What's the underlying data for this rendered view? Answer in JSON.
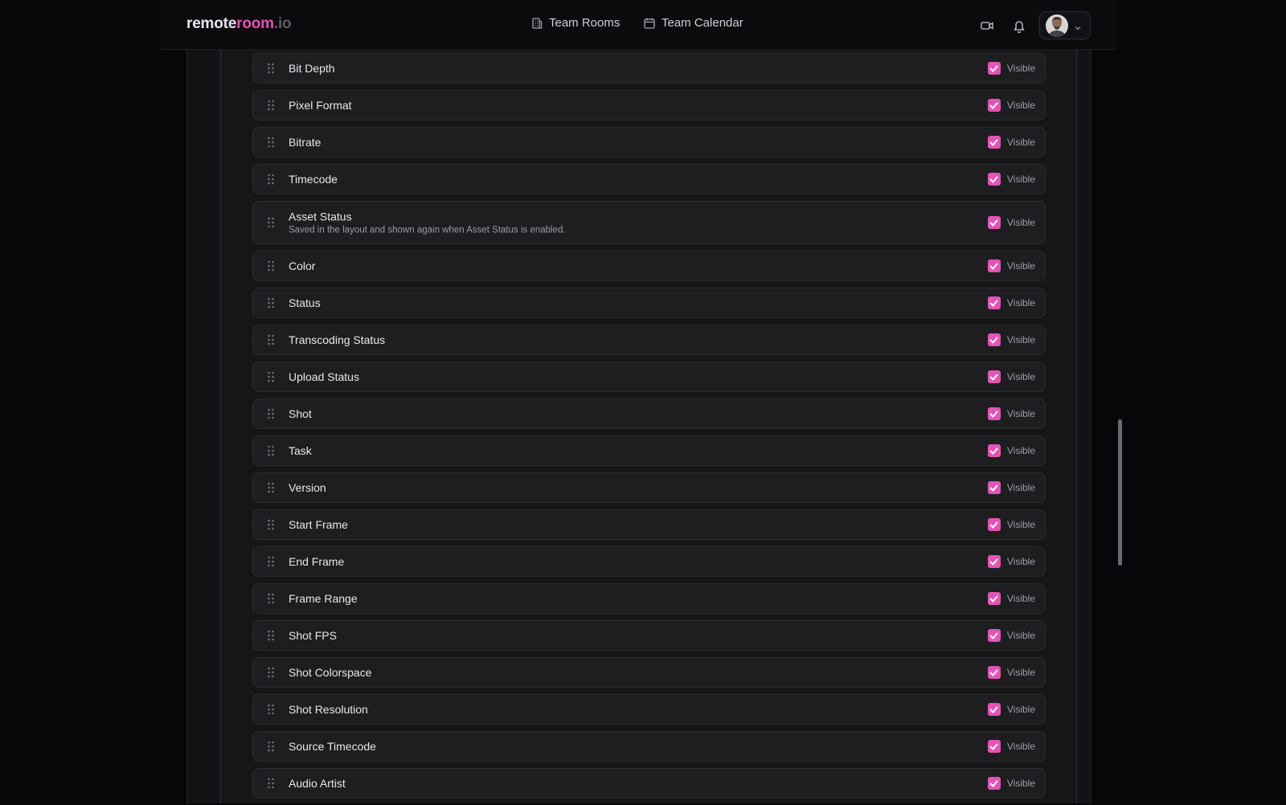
{
  "header": {
    "logo": {
      "part1": "remote",
      "part2": "room",
      "part3": ".io"
    },
    "nav": [
      {
        "label": "Team Rooms",
        "icon": "building-icon"
      },
      {
        "label": "Team Calendar",
        "icon": "calendar-icon"
      }
    ],
    "icons": [
      "video-icon",
      "bell-icon"
    ],
    "user_menu": {
      "avatar": "avatar",
      "icon": "chevron-down-icon"
    }
  },
  "colors": {
    "accent": "#e453b7",
    "background": "#07070a",
    "row_background": "#1e1e21"
  },
  "fields": [
    {
      "label": "Bit Depth",
      "visible": true,
      "visible_label": "Visible"
    },
    {
      "label": "Pixel Format",
      "visible": true,
      "visible_label": "Visible"
    },
    {
      "label": "Bitrate",
      "visible": true,
      "visible_label": "Visible"
    },
    {
      "label": "Timecode",
      "visible": true,
      "visible_label": "Visible"
    },
    {
      "label": "Asset Status",
      "description": "Saved in the layout and shown again when Asset Status is enabled.",
      "visible": true,
      "visible_label": "Visible"
    },
    {
      "label": "Color",
      "visible": true,
      "visible_label": "Visible"
    },
    {
      "label": "Status",
      "visible": true,
      "visible_label": "Visible"
    },
    {
      "label": "Transcoding Status",
      "visible": true,
      "visible_label": "Visible"
    },
    {
      "label": "Upload Status",
      "visible": true,
      "visible_label": "Visible"
    },
    {
      "label": "Shot",
      "visible": true,
      "visible_label": "Visible"
    },
    {
      "label": "Task",
      "visible": true,
      "visible_label": "Visible"
    },
    {
      "label": "Version",
      "visible": true,
      "visible_label": "Visible"
    },
    {
      "label": "Start Frame",
      "visible": true,
      "visible_label": "Visible"
    },
    {
      "label": "End Frame",
      "visible": true,
      "visible_label": "Visible"
    },
    {
      "label": "Frame Range",
      "visible": true,
      "visible_label": "Visible"
    },
    {
      "label": "Shot FPS",
      "visible": true,
      "visible_label": "Visible"
    },
    {
      "label": "Shot Colorspace",
      "visible": true,
      "visible_label": "Visible"
    },
    {
      "label": "Shot Resolution",
      "visible": true,
      "visible_label": "Visible"
    },
    {
      "label": "Source Timecode",
      "visible": true,
      "visible_label": "Visible"
    },
    {
      "label": "Audio Artist",
      "visible": true,
      "visible_label": "Visible"
    }
  ]
}
